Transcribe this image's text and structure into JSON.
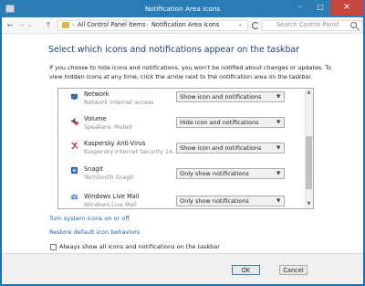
{
  "window": {
    "title": "Notification Area Icons",
    "minimize_glyph": "–",
    "maximize_glyph": "□",
    "close_glyph": "×"
  },
  "nav": {
    "back_glyph": "←",
    "forward_glyph": "→",
    "up_glyph": "↑",
    "caret_glyph": "⌄",
    "crumb_separator": "›",
    "breadcrumbs": [
      "All Control Panel Items",
      "Notification Area Icons"
    ],
    "dropdown_glyph": "⌄",
    "search_placeholder": "Search Control Panel"
  },
  "main": {
    "heading": "Select which icons and notifications appear on the taskbar",
    "description": "If you choose to hide icons and notifications, you won't be notified about changes or updates. To view hidden icons at any time, click the arrow next to the notification area on the taskbar.",
    "rows": [
      {
        "name": "Network",
        "subtitle": "Network Internet access",
        "setting": "Show icon and notifications",
        "icon": "network-icon"
      },
      {
        "name": "Volume",
        "subtitle": "Speakers: Muted",
        "setting": "Hide icon and notifications",
        "icon": "volume-muted-icon"
      },
      {
        "name": "Kaspersky Anti-Virus",
        "subtitle": "Kaspersky Internet Security 14...",
        "setting": "Show icon and notifications",
        "icon": "kaspersky-icon"
      },
      {
        "name": "Snagit",
        "subtitle": "TechSmith Snagit",
        "setting": "Only show notifications",
        "icon": "snagit-icon"
      },
      {
        "name": "Windows Live Mail",
        "subtitle": "Windows Live Mail",
        "setting": "Only show notifications",
        "icon": "mail-icon"
      }
    ],
    "links": [
      "Turn system icons on or off",
      "Restore default icon behaviors"
    ],
    "checkbox_label": "Always show all icons and notifications on the taskbar"
  },
  "footer": {
    "ok_label": "OK",
    "cancel_label": "Cancel"
  },
  "colors": {
    "title_bar": "#2b7bb4",
    "close_button": "#c7463d",
    "heading": "#1e3f7a",
    "link": "#1c5fa8"
  }
}
